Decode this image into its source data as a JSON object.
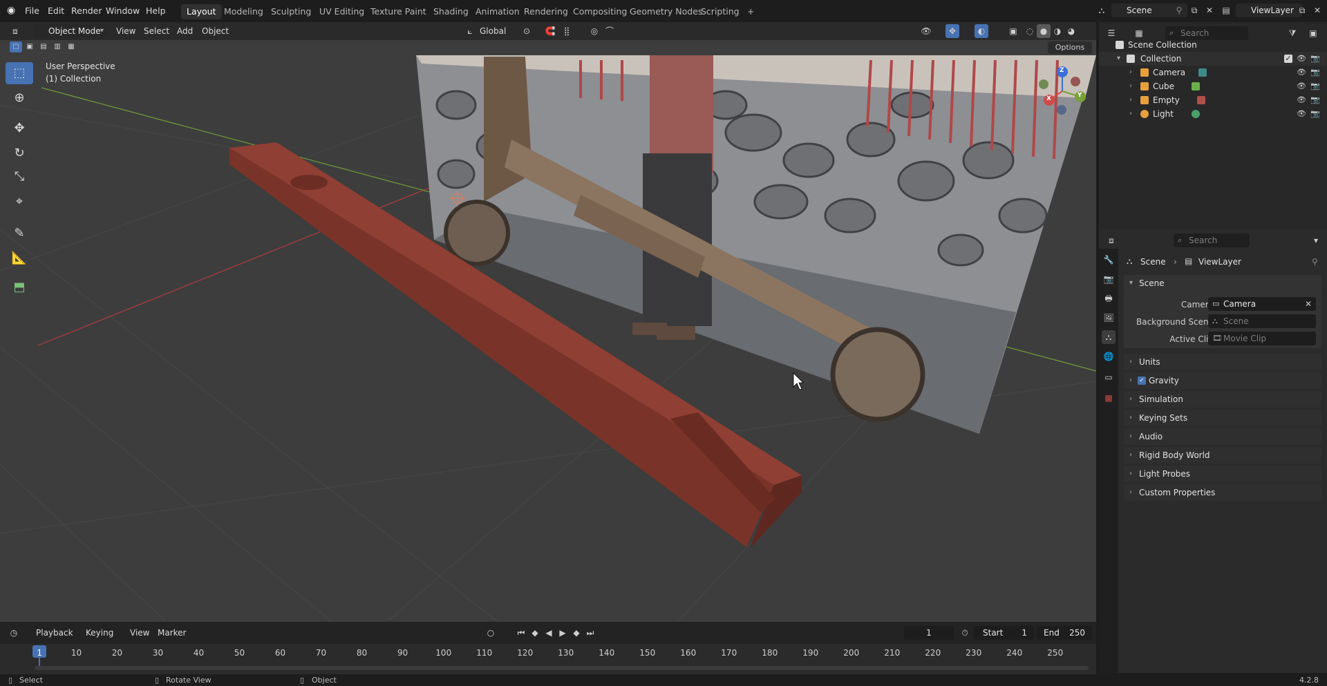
{
  "topbar": {
    "menus": [
      "File",
      "Edit",
      "Render",
      "Window",
      "Help"
    ],
    "workspaces": [
      "Layout",
      "Modeling",
      "Sculpting",
      "UV Editing",
      "Texture Paint",
      "Shading",
      "Animation",
      "Rendering",
      "Compositing",
      "Geometry Nodes",
      "Scripting"
    ],
    "active_workspace": "Layout",
    "scene_name": "Scene",
    "view_layer_name": "ViewLayer",
    "add_tab": "+"
  },
  "viewport_header": {
    "mode": "Object Mode",
    "menus": [
      "View",
      "Select",
      "Add",
      "Object"
    ],
    "transform_orientation": "Global",
    "options_label": "Options"
  },
  "viewport": {
    "perspective_label": "User Perspective",
    "collection_label": "(1) Collection",
    "gizmo": {
      "x": "X",
      "y": "Y",
      "z": "Z"
    },
    "colors": {
      "background": "#3d3d3d",
      "beam": "#8a3a2e",
      "x_axis": "#a33b3b",
      "y_axis": "#6f9a3a",
      "active_tool": "#4772b3"
    }
  },
  "outliner": {
    "search_placeholder": "Search",
    "scene_collection": "Scene Collection",
    "collection": "Collection",
    "items": [
      {
        "name": "Camera",
        "icon": "camera-icon",
        "color": "#e8a03c"
      },
      {
        "name": "Cube",
        "icon": "mesh-icon",
        "color": "#e8a03c"
      },
      {
        "name": "Empty",
        "icon": "empty-icon",
        "color": "#e8a03c"
      },
      {
        "name": "Light",
        "icon": "light-icon",
        "color": "#e8a03c"
      }
    ]
  },
  "properties": {
    "search_placeholder": "Search",
    "breadcrumb_scene": "Scene",
    "breadcrumb_viewlayer": "ViewLayer",
    "scene_panel": "Scene",
    "camera_label": "Camera",
    "camera_value": "Camera",
    "background_scene_label": "Background Scene",
    "background_scene_placeholder": "Scene",
    "active_clip_label": "Active Clip",
    "active_clip_placeholder": "Movie Clip",
    "panels": [
      "Units",
      "Gravity",
      "Simulation",
      "Keying Sets",
      "Audio",
      "Rigid Body World",
      "Light Probes",
      "Custom Properties"
    ],
    "gravity_checked": true
  },
  "timeline": {
    "menus": [
      "Playback",
      "Keying",
      "View",
      "Marker"
    ],
    "current_frame": "1",
    "start_label": "Start",
    "start_value": "1",
    "end_label": "End",
    "end_value": "250",
    "ticks": [
      "1",
      "10",
      "20",
      "30",
      "40",
      "50",
      "60",
      "70",
      "80",
      "90",
      "100",
      "110",
      "120",
      "130",
      "140",
      "150",
      "160",
      "170",
      "180",
      "190",
      "200",
      "210",
      "220",
      "230",
      "240",
      "250"
    ]
  },
  "statusbar": {
    "select": "Select",
    "rotate_view": "Rotate View",
    "object": "Object",
    "version": "4.2.8"
  }
}
